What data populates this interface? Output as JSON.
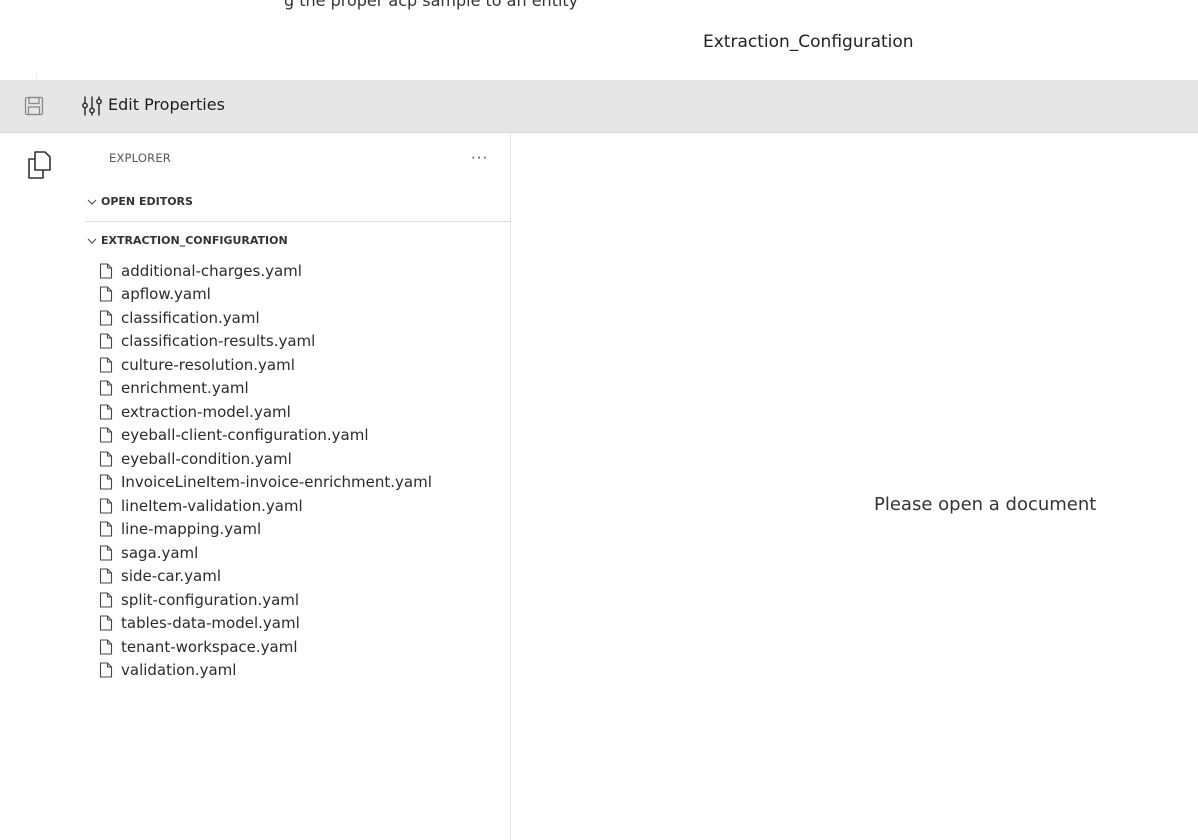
{
  "window": {
    "top_caption": "g the proper acp sample to an entity",
    "title": "Extraction_Configuration"
  },
  "toolbar": {
    "edit_properties_label": "Edit Properties",
    "icons": [
      "save-icon",
      "properties-icon"
    ]
  },
  "activity_bar": {
    "icons": [
      "explorer-icon"
    ]
  },
  "explorer": {
    "header": "EXPLORER",
    "more_actions": "···",
    "open_editors_label": "OPEN EDITORS",
    "folder_label": "EXTRACTION_CONFIGURATION",
    "files": [
      "additional-charges.yaml",
      "apflow.yaml",
      "classification.yaml",
      "classification-results.yaml",
      "culture-resolution.yaml",
      "enrichment.yaml",
      "extraction-model.yaml",
      "eyeball-client-configuration.yaml",
      "eyeball-condition.yaml",
      "InvoiceLineItem-invoice-enrichment.yaml",
      "lineItem-validation.yaml",
      "line-mapping.yaml",
      "saga.yaml",
      "side-car.yaml",
      "split-configuration.yaml",
      "tables-data-model.yaml",
      "tenant-workspace.yaml",
      "validation.yaml"
    ]
  },
  "editor": {
    "empty_message": "Please open a document"
  }
}
